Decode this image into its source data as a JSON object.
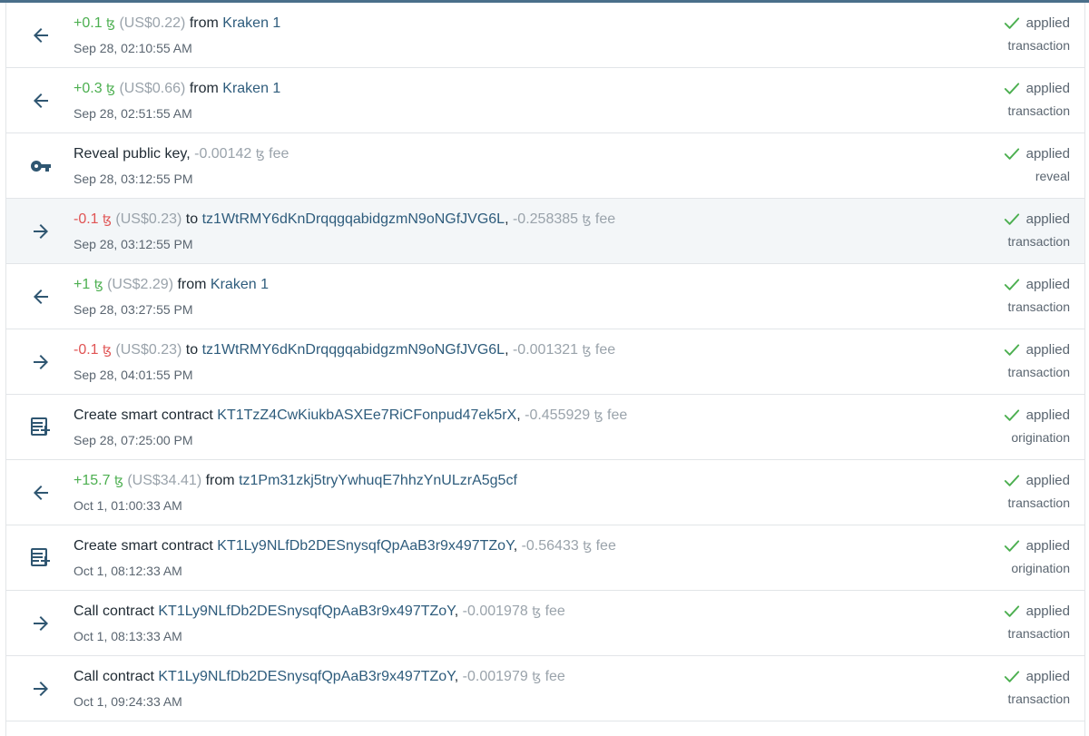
{
  "tez_symbol": "ꜩ",
  "rows": [
    {
      "icon": "arrow-left-icon",
      "amount": "+0.1",
      "amount_kind": "pos",
      "usd": "(US$0.22)",
      "prefix": "",
      "verb": "from",
      "target": "Kraken 1",
      "fee": "",
      "time": "Sep 28, 02:10:55 AM",
      "status": "applied",
      "kind": "transaction"
    },
    {
      "icon": "arrow-left-icon",
      "amount": "+0.3",
      "amount_kind": "pos",
      "usd": "(US$0.66)",
      "prefix": "",
      "verb": "from",
      "target": "Kraken 1",
      "fee": "",
      "time": "Sep 28, 02:51:55 AM",
      "status": "applied",
      "kind": "transaction"
    },
    {
      "icon": "key-icon",
      "amount": "",
      "amount_kind": "",
      "usd": "",
      "prefix": "Reveal public key",
      "verb": "",
      "target": "",
      "fee": "-0.00142",
      "time": "Sep 28, 03:12:55 PM",
      "status": "applied",
      "kind": "reveal"
    },
    {
      "icon": "arrow-right-icon",
      "amount": "-0.1",
      "amount_kind": "neg",
      "usd": "(US$0.23)",
      "prefix": "",
      "verb": "to",
      "target": "tz1WtRMY6dKnDrqqgqabidgzmN9oNGfJVG6L",
      "fee": "-0.258385",
      "time": "Sep 28, 03:12:55 PM",
      "status": "applied",
      "kind": "transaction",
      "highlight": true
    },
    {
      "icon": "arrow-left-icon",
      "amount": "+1",
      "amount_kind": "pos",
      "usd": "(US$2.29)",
      "prefix": "",
      "verb": "from",
      "target": "Kraken 1",
      "fee": "",
      "time": "Sep 28, 03:27:55 PM",
      "status": "applied",
      "kind": "transaction"
    },
    {
      "icon": "arrow-right-icon",
      "amount": "-0.1",
      "amount_kind": "neg",
      "usd": "(US$0.23)",
      "prefix": "",
      "verb": "to",
      "target": "tz1WtRMY6dKnDrqqgqabidgzmN9oNGfJVG6L",
      "fee": "-0.001321",
      "time": "Sep 28, 04:01:55 PM",
      "status": "applied",
      "kind": "transaction"
    },
    {
      "icon": "contract-add-icon",
      "amount": "",
      "amount_kind": "",
      "usd": "",
      "prefix": "Create smart contract",
      "verb": "",
      "target": "KT1TzZ4CwKiukbASXEe7RiCFonpud47ek5rX",
      "fee": "-0.455929",
      "time": "Sep 28, 07:25:00 PM",
      "status": "applied",
      "kind": "origination"
    },
    {
      "icon": "arrow-left-icon",
      "amount": "+15.7",
      "amount_kind": "pos",
      "usd": "(US$34.41)",
      "prefix": "",
      "verb": "from",
      "target": "tz1Pm31zkj5tryYwhuqE7hhzYnULzrA5g5cf",
      "fee": "",
      "time": "Oct 1, 01:00:33 AM",
      "status": "applied",
      "kind": "transaction"
    },
    {
      "icon": "contract-add-icon",
      "amount": "",
      "amount_kind": "",
      "usd": "",
      "prefix": "Create smart contract",
      "verb": "",
      "target": "KT1Ly9NLfDb2DESnysqfQpAaB3r9x497TZoY",
      "fee": "-0.56433",
      "time": "Oct 1, 08:12:33 AM",
      "status": "applied",
      "kind": "origination"
    },
    {
      "icon": "arrow-right-icon",
      "amount": "",
      "amount_kind": "",
      "usd": "",
      "prefix": "Call contract",
      "verb": "",
      "target": "KT1Ly9NLfDb2DESnysqfQpAaB3r9x497TZoY",
      "fee": "-0.001978",
      "time": "Oct 1, 08:13:33 AM",
      "status": "applied",
      "kind": "transaction"
    },
    {
      "icon": "arrow-right-icon",
      "amount": "",
      "amount_kind": "",
      "usd": "",
      "prefix": "Call contract",
      "verb": "",
      "target": "KT1Ly9NLfDb2DESnysqfQpAaB3r9x497TZoY",
      "fee": "-0.001979",
      "time": "Oct 1, 09:24:33 AM",
      "status": "applied",
      "kind": "transaction"
    }
  ],
  "fee_label": "fee",
  "colors": {
    "positive": "#4caf50",
    "negative": "#e05454",
    "link": "#2e5c7c",
    "icon": "#2f5671",
    "top_border": "#4a6f8a"
  }
}
